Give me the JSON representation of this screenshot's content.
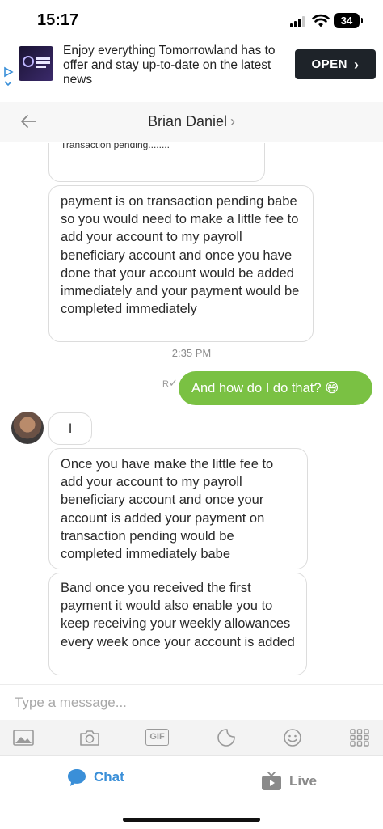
{
  "status": {
    "time": "15:17",
    "battery": "34"
  },
  "ad": {
    "text": "Enjoy everything Tomorrowland has to offer and stay up-to-date on the latest news",
    "button": "OPEN",
    "logo_text": "ONE WORLD RADIO"
  },
  "header": {
    "name": "Brian Daniel",
    "chevron": "›"
  },
  "messages": [
    {
      "from": "them",
      "text": "Transaction pending........"
    },
    {
      "from": "them",
      "text": "payment is on transaction pending babe so you would need to make a little fee to add your account to my payroll beneficiary account and once you have done that your account would be added immediately and your payment would be completed immediately"
    },
    {
      "from": "me",
      "text": "And how do I do that? 😅"
    },
    {
      "from": "them",
      "text": "I"
    },
    {
      "from": "them",
      "text": "Once you have make the little fee to add your account to my payroll beneficiary account and once your account is added your payment on transaction pending would be completed immediately babe"
    },
    {
      "from": "them",
      "text": "Band once you received the first payment it would also enable you to keep receiving your weekly allowances every week once your account is added"
    }
  ],
  "timestamp": "2:35 PM",
  "read_receipt": "R",
  "input": {
    "placeholder": "Type a message..."
  },
  "toolbar": {
    "gif_label": "GIF"
  },
  "nav": {
    "chat": "Chat",
    "live": "Live"
  },
  "colors": {
    "outgoing": "#7ac143",
    "accent": "#3a8fd8",
    "ad_button": "#1e2329"
  }
}
